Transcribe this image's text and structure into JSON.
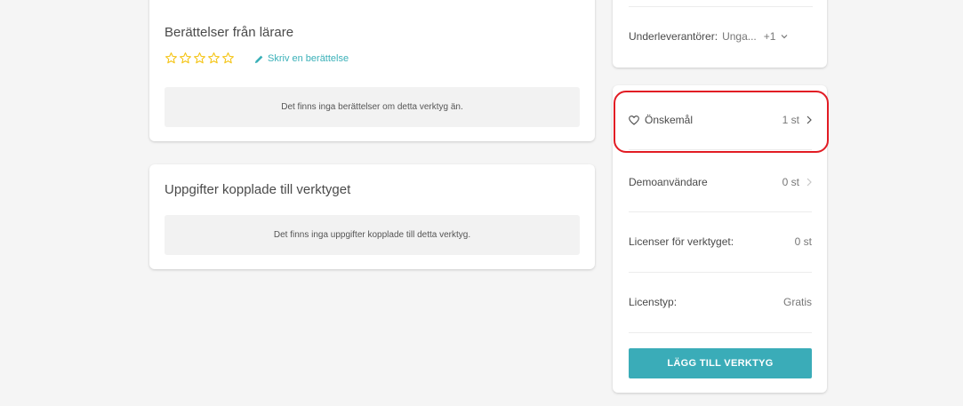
{
  "stories": {
    "title": "Berättelser från lärare",
    "rating_stars": 5,
    "rating_value": 0,
    "write_link": "Skriv en berättelse",
    "empty_text": "Det finns inga berättelser om detta verktyg än."
  },
  "tasks": {
    "title": "Uppgifter kopplade till verktyget",
    "empty_text": "Det finns inga uppgifter kopplade till detta verktyg."
  },
  "subcontractors": {
    "label": "Underleverantörer:",
    "value": "Unga...",
    "extra": "+1"
  },
  "info": {
    "wishlist": {
      "label": "Önskemål",
      "value": "1 st"
    },
    "demo_users": {
      "label": "Demoanvändare",
      "value": "0 st"
    },
    "licenses": {
      "label": "Licenser för verktyget:",
      "value": "0 st"
    },
    "license_type": {
      "label": "Licenstyp:",
      "value": "Gratis"
    },
    "add_button": "LÄGG TILL VERKTYG"
  },
  "colors": {
    "accent": "#3aacb8",
    "star": "#f5c518",
    "highlight": "#e21c24"
  },
  "icons": {
    "star": "star-outline-icon",
    "pencil": "pencil-icon",
    "heart": "heart-outline-icon",
    "chevron_down": "chevron-down-icon",
    "chevron_right": "chevron-right-icon"
  }
}
